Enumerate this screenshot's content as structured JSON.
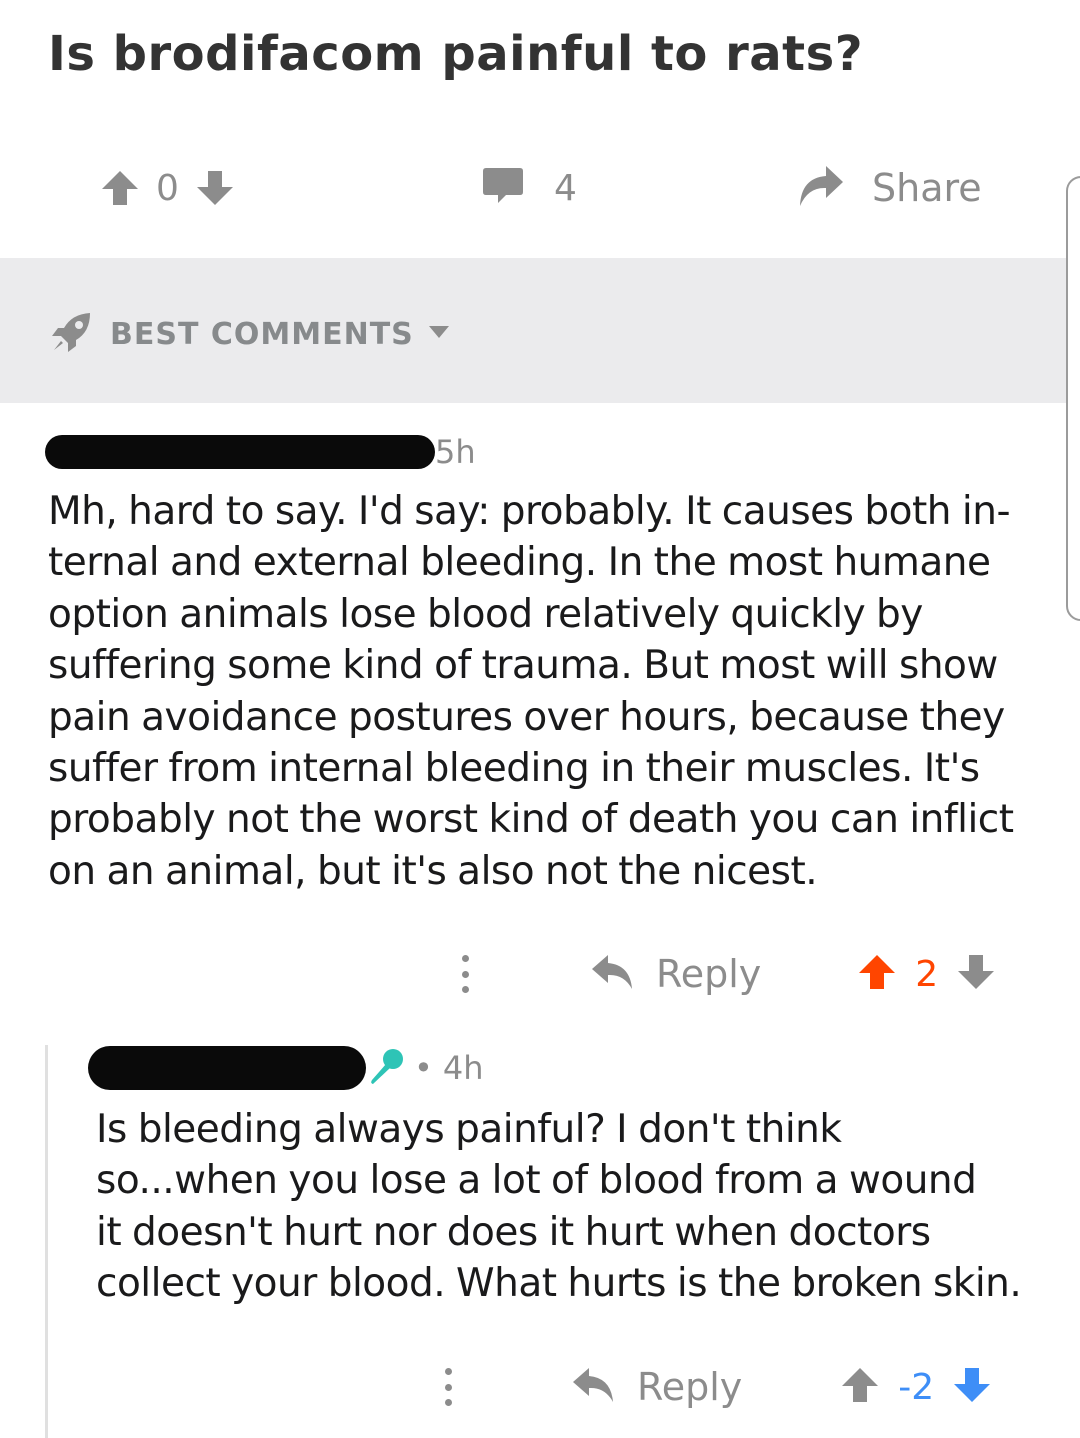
{
  "post": {
    "title": "Is brodifacom painful to rats?",
    "score": "0",
    "comment_count": "4",
    "share_label": "Share"
  },
  "sort": {
    "label": "BEST COMMENTS"
  },
  "comments": [
    {
      "author_redacted": true,
      "time": "5h",
      "body_lines": [
        "Mh, hard to say. I'd say: probably. It causes both in-",
        "ternal and external bleeding. In the most humane",
        "option animals lose blood relatively quickly by",
        "suffering some kind of trauma. But most will show",
        "pain avoidance postures over hours, because they",
        "suffer from internal bleeding in their muscles. It's",
        "probably not the worst kind of death you can inflict",
        "on an animal, but it's also not the nicest."
      ],
      "reply_label": "Reply",
      "score": "2",
      "vote_state": "upvoted"
    },
    {
      "author_redacted": true,
      "meta_separator": "•",
      "time": "4h",
      "body_lines": [
        "Is bleeding always painful? I don't think",
        "so...when you lose a lot of blood from a wound",
        "it doesn't hurt nor does it hurt when doctors",
        "collect your blood. What hurts is the broken skin."
      ],
      "reply_label": "Reply",
      "score": "-2",
      "vote_state": "downvoted"
    }
  ],
  "icons": {
    "upvote": "arrow-up-icon",
    "downvote": "arrow-down-icon",
    "comment": "speech-bubble-icon",
    "share": "share-arrow-icon",
    "sort": "rocket-icon",
    "dropdown": "caret-down-icon",
    "reply": "reply-arrow-icon",
    "more": "vertical-dots-icon",
    "flair": "microphone-icon"
  },
  "colors": {
    "upvote": "#ff4500",
    "downvote": "#3e8ef7",
    "muted": "#8c8c8c",
    "sort_bar_bg": "#ebebed",
    "flair": "#2ec4b6"
  }
}
